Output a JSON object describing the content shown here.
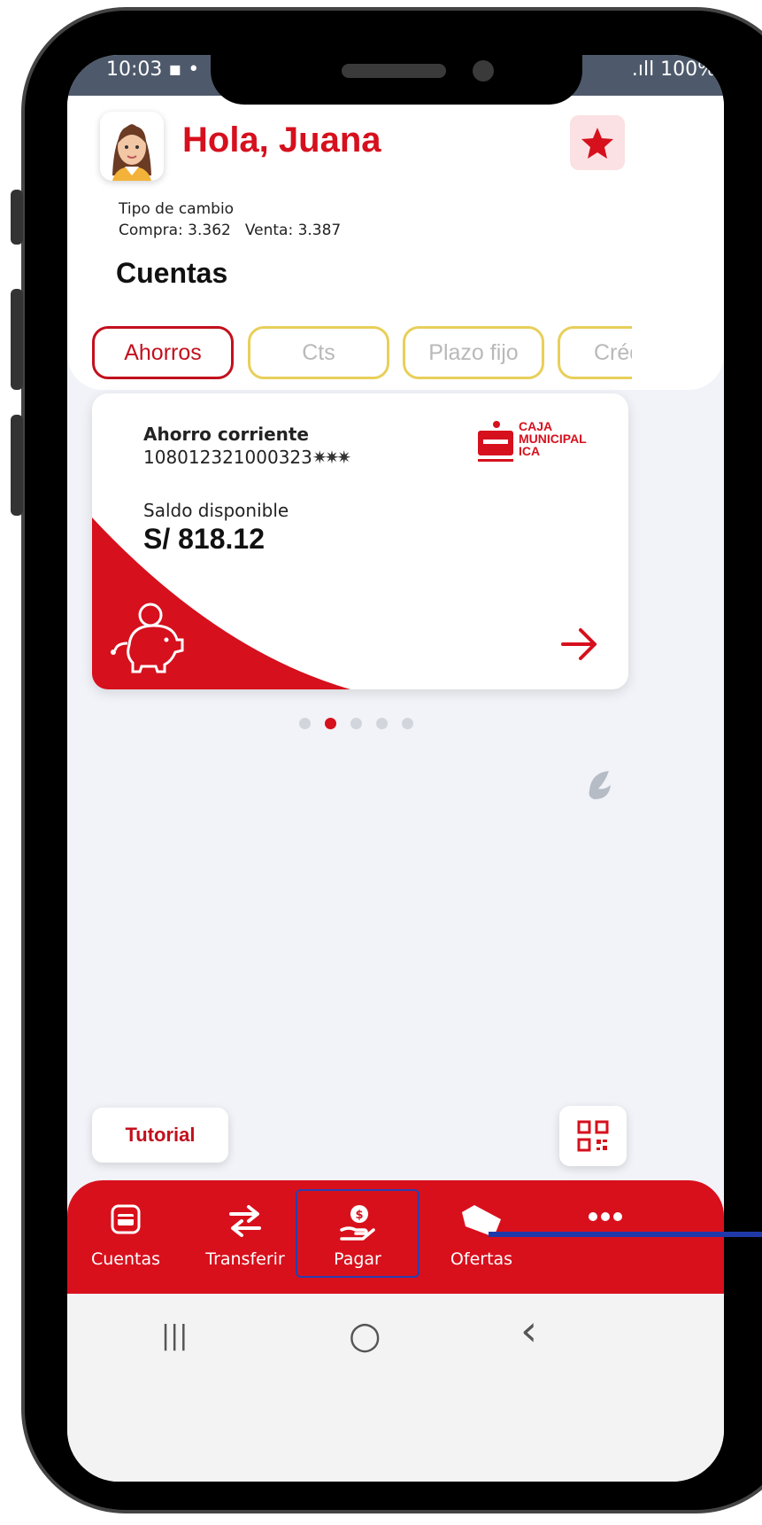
{
  "status_bar": {
    "time": "10:03 ▪ •",
    "indicators": ".ıll 100%▪"
  },
  "header": {
    "greeting": "Hola, Juana",
    "favorite_icon": "star-icon",
    "exchange": {
      "title": "Tipo de cambio",
      "buy": "Compra: 3.362",
      "sell": "Venta: 3.387"
    },
    "section_title": "Cuentas"
  },
  "tabs": [
    {
      "label": "Ahorros",
      "active": true
    },
    {
      "label": "Cts",
      "active": false
    },
    {
      "label": "Plazo fijo",
      "active": false
    },
    {
      "label": "Créd",
      "active": false
    }
  ],
  "account_card": {
    "type": "Ahorro corriente",
    "number": "108012321000323",
    "number_mask": "✷✷✷",
    "balance_label": "Saldo disponible",
    "balance": "S/ 818.12",
    "bank_logo_text": [
      "CAJA",
      "MUNICIPAL",
      "ICA"
    ]
  },
  "pagination": {
    "total": 5,
    "active_index": 1
  },
  "actions": {
    "tutorial_label": "Tutorial",
    "qr_icon": "qr-code-icon"
  },
  "bottom_nav": [
    {
      "label": "Cuentas",
      "icon": "wallet-icon"
    },
    {
      "label": "Transferir",
      "icon": "transfer-arrows-icon"
    },
    {
      "label": "Pagar",
      "icon": "pay-hand-icon",
      "highlighted": true
    },
    {
      "label": "Ofertas",
      "icon": "tag-icon"
    },
    {
      "label": "",
      "icon": "more-dots-icon"
    }
  ],
  "system_nav": {
    "recents": "|||",
    "home": "○",
    "back": "‹"
  },
  "colors": {
    "brand_red": "#d6101d",
    "tab_border": "#e8cf5a",
    "callout_blue": "#1f3aa8"
  }
}
